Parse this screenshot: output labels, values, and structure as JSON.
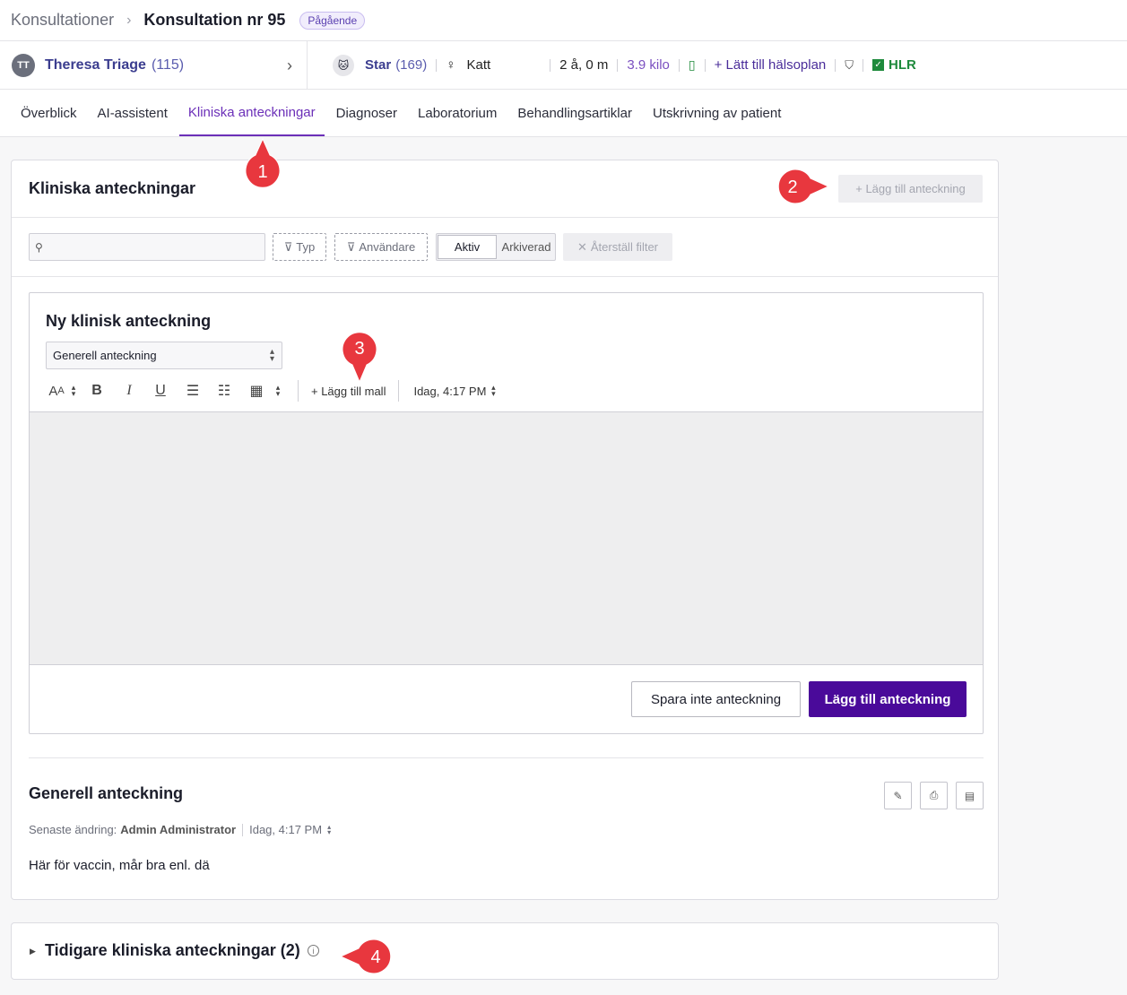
{
  "breadcrumb": {
    "parent": "Konsultationer",
    "current": "Konsultation nr 95",
    "status": "Pågående"
  },
  "owner": {
    "initials": "TT",
    "name": "Theresa Triage",
    "id": "(115)"
  },
  "pet": {
    "name": "Star",
    "id": "(169)",
    "species": "Katt",
    "age": "2 å, 0 m",
    "weight": "3.9 kilo",
    "health_plan": "+ Lätt till hälsoplan",
    "hlr": "HLR"
  },
  "tabs": [
    "Överblick",
    "AI-assistent",
    "Kliniska anteckningar",
    "Diagnoser",
    "Laboratorium",
    "Behandlingsartiklar",
    "Utskrivning av patient"
  ],
  "active_tab": "Kliniska anteckningar",
  "panel": {
    "title": "Kliniska anteckningar",
    "add_button": "+ Lägg till anteckning",
    "search_placeholder": "",
    "filter_type": "Typ",
    "filter_user": "Användare",
    "seg_active": "Aktiv",
    "seg_archived": "Arkiverad",
    "reset_filter": "Återställ filter"
  },
  "new_note": {
    "title": "Ny klinisk anteckning",
    "type_select": "Generell anteckning",
    "add_template": "+ Lägg till mall",
    "datetime": "Idag, 4:17 PM",
    "cancel": "Spara inte anteckning",
    "submit": "Lägg till anteckning"
  },
  "note": {
    "title": "Generell anteckning",
    "meta_label": "Senaste ändring:",
    "author": "Admin Administrator",
    "datetime": "Idag, 4:17 PM",
    "text": "Här för vaccin, mår bra enl. dä"
  },
  "previous": {
    "title": "Tidigare kliniska anteckningar (2)"
  },
  "callouts": [
    "1",
    "2",
    "3",
    "4"
  ],
  "colors": {
    "accent": "#6b2fb8",
    "primary_button": "#4a0a9a",
    "callout": "#e8373e",
    "hlr": "#1e8a3c"
  }
}
